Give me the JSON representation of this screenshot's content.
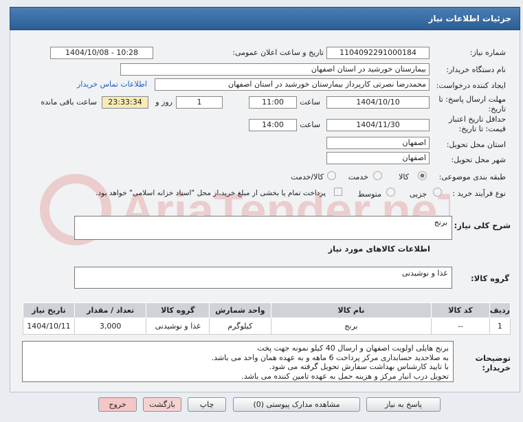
{
  "header": {
    "title": "جزئیات اطلاعات نیاز"
  },
  "need_number": {
    "label": "شماره نیاز:",
    "value": "1104092291000184"
  },
  "announce": {
    "label": "تاریخ و ساعت اعلان عمومی:",
    "value": "1404/10/08 - 10:28"
  },
  "buyer": {
    "label": "نام دستگاه خریدار:",
    "value": "بیمارستان خورشید در استان اصفهان"
  },
  "requester": {
    "label": "ایجاد کننده درخواست:",
    "value": "محمدرضا نصرتی کارپرداز بیمارستان خورشید در استان اصفهان",
    "contact_link": "اطلاعات تماس خریدار"
  },
  "deadline": {
    "label1": "مهلت ارسال پاسخ: تا",
    "label2": "تاریخ:",
    "date": "1404/10/10",
    "time_label": "ساعت",
    "time": "11:00",
    "days": "1",
    "days_label": "روز و",
    "remaining": "23:33:34",
    "remaining_label": "ساعت باقی مانده"
  },
  "validity": {
    "label1": "حداقل تاریخ اعتبار",
    "label2": "قیمت: تا تاریخ:",
    "date": "1404/11/30",
    "time_label": "ساعت",
    "time": "14:00"
  },
  "province": {
    "label": "استان محل تحویل:",
    "value": "اصفهان"
  },
  "city": {
    "label": "شهر محل تحویل:",
    "value": "اصفهان"
  },
  "category": {
    "label": "طبقه بندی موضوعی:",
    "opt1": "کالا",
    "opt2": "خدمت",
    "opt3": "کالا/خدمت",
    "selected": "کالا"
  },
  "purchase": {
    "label": "نوع فرآیند خرید :",
    "opt1": "جزیی",
    "opt2": "متوسط",
    "note": "پرداخت تمام یا بخشی از مبلغ خرید،از محل \"اسناد خزانه اسلامی\" خواهد بود."
  },
  "description": {
    "label": "شرح کلی نیاز:",
    "value": "برنج"
  },
  "goods_info_title": "اطلاعات کالاهای مورد نیاز",
  "goods_group": {
    "label": "گروه کالا:",
    "value": "غذا و نوشیدنی"
  },
  "table": {
    "headers": [
      "ردیف",
      "کد کالا",
      "نام کالا",
      "واحد شمارش",
      "گروه کالا",
      "تعداد / مقدار",
      "تاریخ نیاز"
    ],
    "rows": [
      [
        "1",
        "--",
        "برنج",
        "کیلوگرم",
        "غذا و نوشیدنی",
        "3,000",
        "1404/10/11"
      ]
    ]
  },
  "buyer_notes": {
    "label1": "توضیحات",
    "label2": "خریدار:",
    "lines": [
      "برنج هایلی اولویت اصفهان و ارسال 40 کیلو نمونه جهت پخت",
      "به صلاحدید حسابداری مرکز پرداخت 6 ماهه و به عهده همان واحد می باشد.",
      "با تایید کارشناس بهداشت سفارش تحویل گرفته می شود.",
      "تحویل درب انبار مرکز و هزینه حمل به عهده تامین کننده می باشد."
    ]
  },
  "buttons": {
    "reply": "پاسخ به نیاز",
    "attachments": "مشاهده مدارک پیوستی (0)",
    "print": "چاپ",
    "back": "بازگشت",
    "exit": "خروج"
  },
  "watermark": "AriaTender.neT",
  "colors": {
    "header": "#2f6399",
    "remaining_bg": "#f7ecb5",
    "exit_bg": "#f5c6c6",
    "back_bg": "#f5d2d2"
  }
}
